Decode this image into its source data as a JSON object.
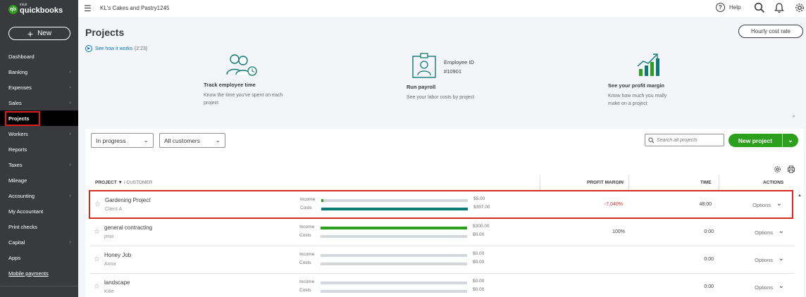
{
  "brand": {
    "logo_mark": "qb",
    "intuit": "intuit",
    "name": "quickbooks"
  },
  "sidebar": {
    "new_label": "New",
    "items": [
      {
        "label": "Dashboard",
        "chevron": false
      },
      {
        "label": "Banking",
        "chevron": true
      },
      {
        "label": "Expenses",
        "chevron": true
      },
      {
        "label": "Sales",
        "chevron": true
      },
      {
        "label": "Projects",
        "chevron": false,
        "active": true
      },
      {
        "label": "Workers",
        "chevron": true
      },
      {
        "label": "Reports",
        "chevron": false
      },
      {
        "label": "Taxes",
        "chevron": true
      },
      {
        "label": "Mileage",
        "chevron": false
      },
      {
        "label": "Accounting",
        "chevron": true
      },
      {
        "label": "My Accountant",
        "chevron": false
      },
      {
        "label": "Print checks",
        "chevron": false
      },
      {
        "label": "Capital",
        "chevron": true
      },
      {
        "label": "Apps",
        "chevron": false
      },
      {
        "label": "Mobile payments",
        "chevron": false
      }
    ]
  },
  "topbar": {
    "company": "KL's Cakes and Pastry1245",
    "help": "Help",
    "icons": [
      "menu-icon",
      "help-icon",
      "search-icon",
      "bell-icon",
      "gear-icon"
    ]
  },
  "page": {
    "title": "Projects",
    "hourly_cost_rate": "Hourly cost rate"
  },
  "intro": {
    "how_link": "See how it works",
    "how_duration": "(2:23)",
    "features": [
      {
        "title": "Track employee time",
        "desc": "Know the time you've spent on each project"
      },
      {
        "title": "Run payroll",
        "desc": "See your labor costs by project"
      },
      {
        "title": "See your profit margin",
        "desc": "Know how much you really make on a project"
      }
    ],
    "employee_id_label": "Employee ID",
    "employee_id_value": "#10901",
    "collapse": "^"
  },
  "filters": {
    "status": "In progress",
    "customers": "All customers",
    "search_placeholder": "Search all projects",
    "new_project": "New project"
  },
  "table": {
    "headers": {
      "project": "PROJECT",
      "sort_glyph": "▼",
      "customer": "/ CUSTOMER",
      "profit_margin": "PROFIT MARGIN",
      "time": "TIME",
      "actions": "ACTIONS"
    },
    "income_label": "Income",
    "costs_label": "Costs",
    "options_label": "Options",
    "rows": [
      {
        "name": "Gardening Project",
        "customer": "Client A",
        "income": "$5.00",
        "costs": "$357.00",
        "income_fill": 0.014,
        "costs_fill": 1.0,
        "margin": "-7,040%",
        "time": "48:00",
        "selected": true
      },
      {
        "name": "general contracting",
        "customer": "jeno",
        "income": "$300.00",
        "costs": "$0.00",
        "income_fill": 1.0,
        "costs_fill": 0,
        "margin": "100%",
        "time": "0:00",
        "selected": false
      },
      {
        "name": "Honey Job",
        "customer": "Anna",
        "income": "$0.00",
        "costs": "$0.00",
        "income_fill": 0,
        "costs_fill": 0,
        "margin": "",
        "time": "0:00",
        "selected": false
      },
      {
        "name": "landscape",
        "customer": "Kitie",
        "income": "$0.00",
        "costs": "$0.00",
        "income_fill": 0,
        "costs_fill": 0,
        "margin": "",
        "time": "0:00",
        "selected": false
      }
    ]
  },
  "colors": {
    "sidebar_bg": "#393a3d",
    "brand_green": "#2ca01c",
    "cost_teal": "#0d7a77",
    "negative_red": "#d52b1e",
    "link_blue": "#0077c5"
  }
}
